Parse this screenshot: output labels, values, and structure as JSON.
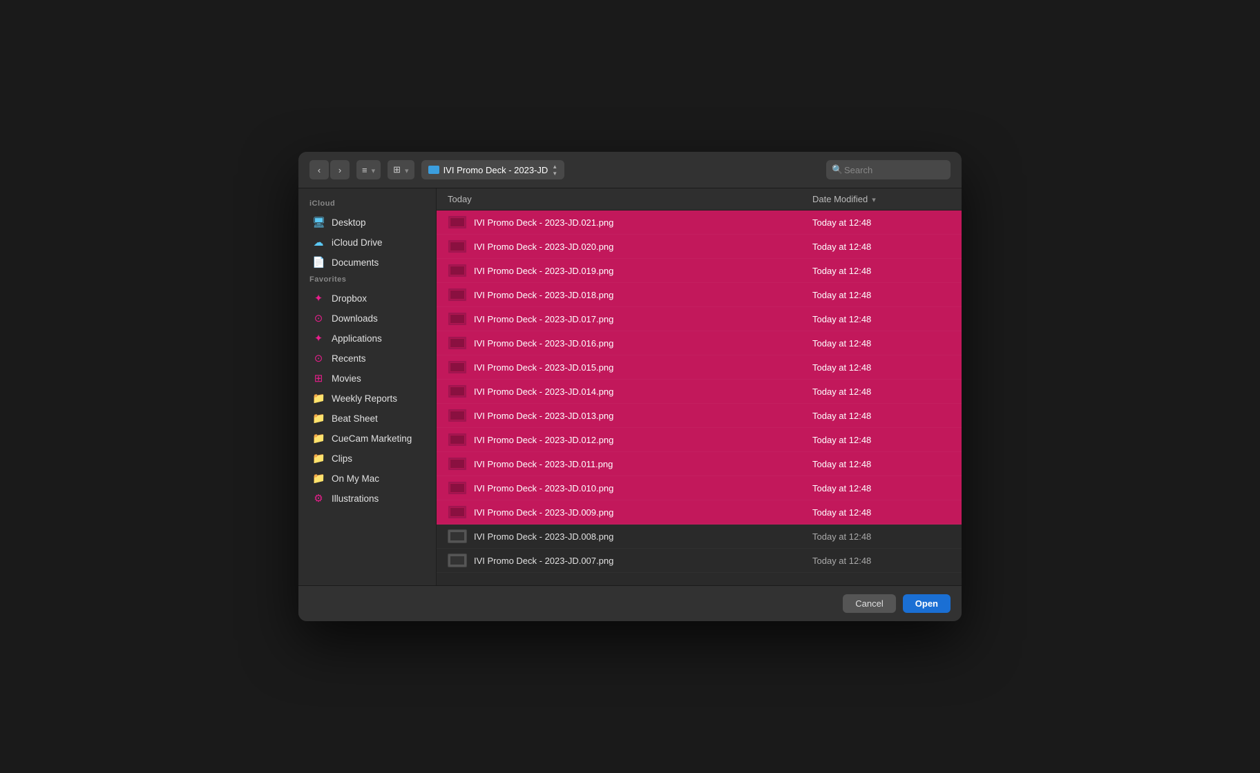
{
  "toolbar": {
    "back_label": "‹",
    "forward_label": "›",
    "list_view_label": "≡",
    "grid_view_label": "⊞",
    "folder_name": "IVI Promo Deck - 2023-JD",
    "search_placeholder": "Search"
  },
  "sidebar": {
    "icloud_section": "iCloud",
    "favorites_section": "Favorites",
    "items": [
      {
        "id": "desktop",
        "label": "Desktop",
        "icon": "🖥",
        "icon_class": "icon-desktop"
      },
      {
        "id": "icloud-drive",
        "label": "iCloud Drive",
        "icon": "☁",
        "icon_class": "icon-icloud"
      },
      {
        "id": "documents",
        "label": "Documents",
        "icon": "📄",
        "icon_class": "icon-documents"
      },
      {
        "id": "dropbox",
        "label": "Dropbox",
        "icon": "❖",
        "icon_class": "icon-dropbox"
      },
      {
        "id": "downloads",
        "label": "Downloads",
        "icon": "⊙",
        "icon_class": "icon-downloads"
      },
      {
        "id": "applications",
        "label": "Applications",
        "icon": "⚙",
        "icon_class": "icon-applications"
      },
      {
        "id": "recents",
        "label": "Recents",
        "icon": "⊙",
        "icon_class": "icon-recents"
      },
      {
        "id": "movies",
        "label": "Movies",
        "icon": "⊞",
        "icon_class": "icon-movies"
      },
      {
        "id": "weekly-reports",
        "label": "Weekly Reports",
        "icon": "📁",
        "icon_class": "icon-folder"
      },
      {
        "id": "beat-sheet",
        "label": "Beat Sheet",
        "icon": "📁",
        "icon_class": "icon-folder"
      },
      {
        "id": "cuecam-marketing",
        "label": "CueCam Marketing",
        "icon": "📁",
        "icon_class": "icon-folder"
      },
      {
        "id": "clips",
        "label": "Clips",
        "icon": "📁",
        "icon_class": "icon-folder"
      },
      {
        "id": "on-my-mac",
        "label": "On My Mac",
        "icon": "📁",
        "icon_class": "icon-folder"
      },
      {
        "id": "illustrations",
        "label": "Illustrations",
        "icon": "⚙",
        "icon_class": "icon-gear"
      }
    ]
  },
  "file_list": {
    "col_name": "Today",
    "col_date": "Date Modified",
    "files": [
      {
        "name": "IVI Promo Deck - 2023-JD.021.png",
        "date": "Today at 12:48",
        "selected": true
      },
      {
        "name": "IVI Promo Deck - 2023-JD.020.png",
        "date": "Today at 12:48",
        "selected": true
      },
      {
        "name": "IVI Promo Deck - 2023-JD.019.png",
        "date": "Today at 12:48",
        "selected": true
      },
      {
        "name": "IVI Promo Deck - 2023-JD.018.png",
        "date": "Today at 12:48",
        "selected": true
      },
      {
        "name": "IVI Promo Deck - 2023-JD.017.png",
        "date": "Today at 12:48",
        "selected": true
      },
      {
        "name": "IVI Promo Deck - 2023-JD.016.png",
        "date": "Today at 12:48",
        "selected": true
      },
      {
        "name": "IVI Promo Deck - 2023-JD.015.png",
        "date": "Today at 12:48",
        "selected": true
      },
      {
        "name": "IVI Promo Deck - 2023-JD.014.png",
        "date": "Today at 12:48",
        "selected": true
      },
      {
        "name": "IVI Promo Deck - 2023-JD.013.png",
        "date": "Today at 12:48",
        "selected": true
      },
      {
        "name": "IVI Promo Deck - 2023-JD.012.png",
        "date": "Today at 12:48",
        "selected": true
      },
      {
        "name": "IVI Promo Deck - 2023-JD.011.png",
        "date": "Today at 12:48",
        "selected": true
      },
      {
        "name": "IVI Promo Deck - 2023-JD.010.png",
        "date": "Today at 12:48",
        "selected": true
      },
      {
        "name": "IVI Promo Deck - 2023-JD.009.png",
        "date": "Today at 12:48",
        "selected": true
      },
      {
        "name": "IVI Promo Deck - 2023-JD.008.png",
        "date": "Today at 12:48",
        "selected": false
      },
      {
        "name": "IVI Promo Deck - 2023-JD.007.png",
        "date": "Today at 12:48",
        "selected": false
      }
    ]
  },
  "buttons": {
    "cancel_label": "Cancel",
    "open_label": "Open"
  }
}
